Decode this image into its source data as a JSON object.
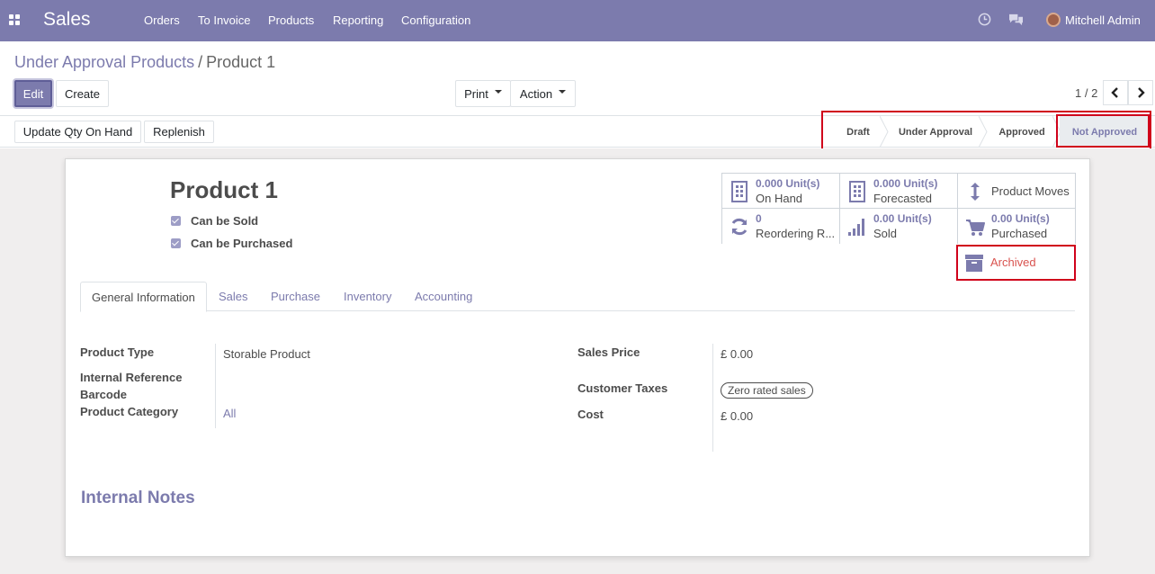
{
  "navbar": {
    "app_name": "Sales",
    "menus": [
      "Orders",
      "To Invoice",
      "Products",
      "Reporting",
      "Configuration"
    ],
    "user_name": "Mitchell Admin",
    "icons": [
      "apps-grid-icon",
      "clock-icon",
      "chat-icon"
    ],
    "color": "#7c7bad"
  },
  "breadcrumb": {
    "parent": "Under Approval Products",
    "separator": "/",
    "current": "Product 1"
  },
  "toolbar": {
    "edit_label": "Edit",
    "create_label": "Create",
    "print_label": "Print",
    "action_label": "Action"
  },
  "pager": {
    "value": "1 / 2"
  },
  "header_buttons": {
    "update_qty_label": "Update Qty On Hand",
    "replenish_label": "Replenish"
  },
  "statusbar": {
    "stages": [
      "Draft",
      "Under Approval",
      "Approved",
      "Not Approved"
    ],
    "current": "Not Approved"
  },
  "product": {
    "name": "Product 1",
    "can_be_sold_label": "Can be Sold",
    "can_be_sold": true,
    "can_be_purchased_label": "Can be Purchased",
    "can_be_purchased": true
  },
  "smart_buttons": {
    "on_hand": {
      "value": "0.000",
      "unit": "Unit(s)",
      "label": "On Hand"
    },
    "forecasted": {
      "value": "0.000",
      "unit": "Unit(s)",
      "label": "Forecasted"
    },
    "product_moves": {
      "label": "Product Moves"
    },
    "reordering": {
      "value": "0",
      "label": "Reordering R..."
    },
    "sold": {
      "value": "0.00",
      "unit": "Unit(s)",
      "label": "Sold"
    },
    "purchased": {
      "value": "0.00",
      "unit": "Unit(s)",
      "label": "Purchased"
    },
    "archived": {
      "label": "Archived"
    }
  },
  "tabs": [
    "General Information",
    "Sales",
    "Purchase",
    "Inventory",
    "Accounting"
  ],
  "active_tab": "General Information",
  "fields": {
    "product_type_label": "Product Type",
    "product_type": "Storable Product",
    "internal_reference_label": "Internal Reference",
    "barcode_label": "Barcode",
    "product_category_label": "Product Category",
    "product_category": "All",
    "sales_price_label": "Sales Price",
    "sales_price": "£ 0.00",
    "customer_taxes_label": "Customer Taxes",
    "customer_taxes": "Zero rated sales",
    "cost_label": "Cost",
    "cost": "£ 0.00"
  },
  "internal_notes_title": "Internal Notes"
}
